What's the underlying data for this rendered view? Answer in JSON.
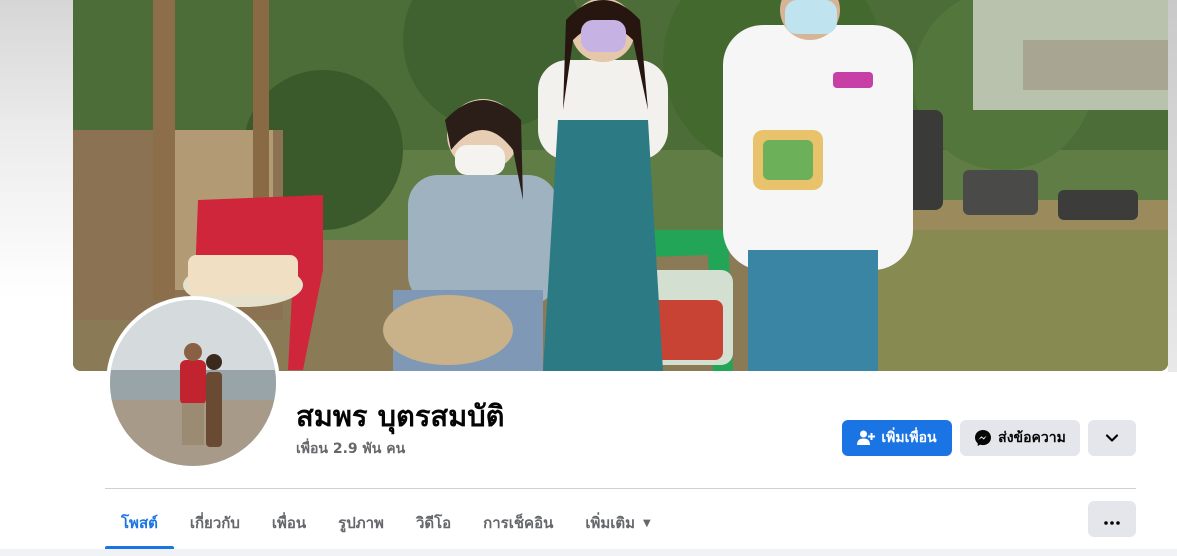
{
  "profile": {
    "name": "สมพร บุตรสมบัติ",
    "friends_count": "เพื่อน 2.9 พัน คน"
  },
  "actions": {
    "add_friend_label": "เพิ่มเพื่อน",
    "message_label": "ส่งข้อความ",
    "add_friend_icon": "person-add-icon",
    "message_icon": "messenger-icon",
    "dropdown_icon": "chevron-down-icon"
  },
  "tabs": [
    {
      "label": "โพสต์",
      "active": true
    },
    {
      "label": "เกี่ยวกับ",
      "active": false
    },
    {
      "label": "เพื่อน",
      "active": false
    },
    {
      "label": "รูปภาพ",
      "active": false
    },
    {
      "label": "วิดีโอ",
      "active": false
    },
    {
      "label": "การเช็คอิน",
      "active": false
    },
    {
      "label": "เพิ่มเติม",
      "active": false
    }
  ],
  "more_menu_icon": "ellipsis-icon",
  "colors": {
    "primary": "#1b74e4",
    "secondary_button": "#e4e6eb",
    "muted_text": "#65676b",
    "text": "#050505"
  }
}
